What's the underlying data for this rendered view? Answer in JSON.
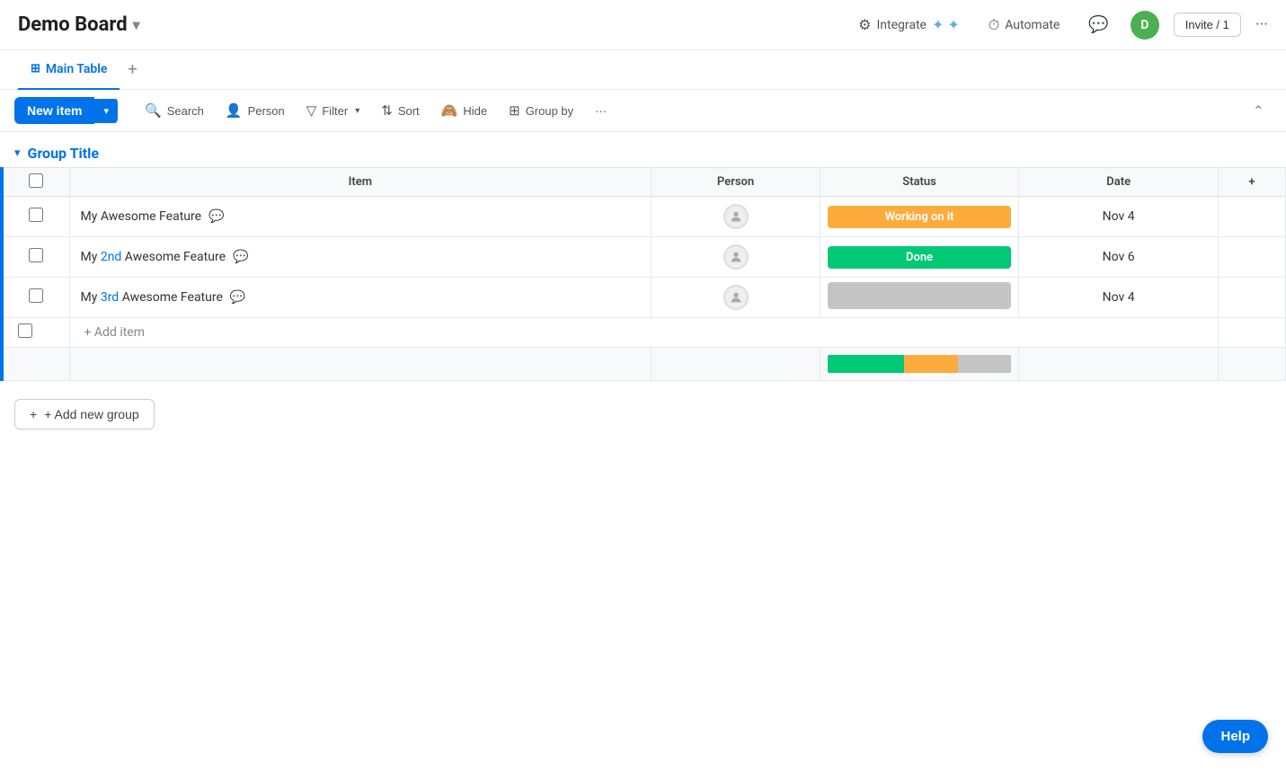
{
  "header": {
    "board_title": "Demo Board",
    "chevron": "▾",
    "integrate_label": "Integrate",
    "automate_label": "Automate",
    "avatar_letter": "D",
    "invite_label": "Invite / 1",
    "more_dots": "···"
  },
  "tabs": [
    {
      "label": "Main Table",
      "active": true
    },
    {
      "label": "+",
      "is_add": true
    }
  ],
  "toolbar": {
    "new_item_label": "New item",
    "new_item_arrow": "▾",
    "search_label": "Search",
    "person_label": "Person",
    "filter_label": "Filter",
    "filter_arrow": "▾",
    "sort_label": "Sort",
    "hide_label": "Hide",
    "group_by_label": "Group by",
    "more_label": "···",
    "collapse_label": "⌃"
  },
  "group": {
    "title": "Group Title",
    "chevron": "▾"
  },
  "table": {
    "columns": [
      "Item",
      "Person",
      "Status",
      "Date",
      "+"
    ],
    "rows": [
      {
        "name": "My Awesome Feature",
        "name_parts": [
          "My Awesome Feature"
        ],
        "person": "",
        "status": "Working on it",
        "status_class": "status-working",
        "date": "Nov 4"
      },
      {
        "name": "My 2nd Awesome Feature",
        "name_parts": [
          "My ",
          "2nd",
          " Awesome Feature"
        ],
        "person": "",
        "status": "Done",
        "status_class": "status-done",
        "date": "Nov 6"
      },
      {
        "name": "My 3rd Awesome Feature",
        "name_parts": [
          "My ",
          "3rd",
          " Awesome Feature"
        ],
        "person": "",
        "status": "",
        "status_class": "status-empty",
        "date": "Nov 4"
      }
    ],
    "add_item_label": "+ Add item"
  },
  "add_group": {
    "label": "+ Add new group"
  },
  "help": {
    "label": "Help"
  }
}
